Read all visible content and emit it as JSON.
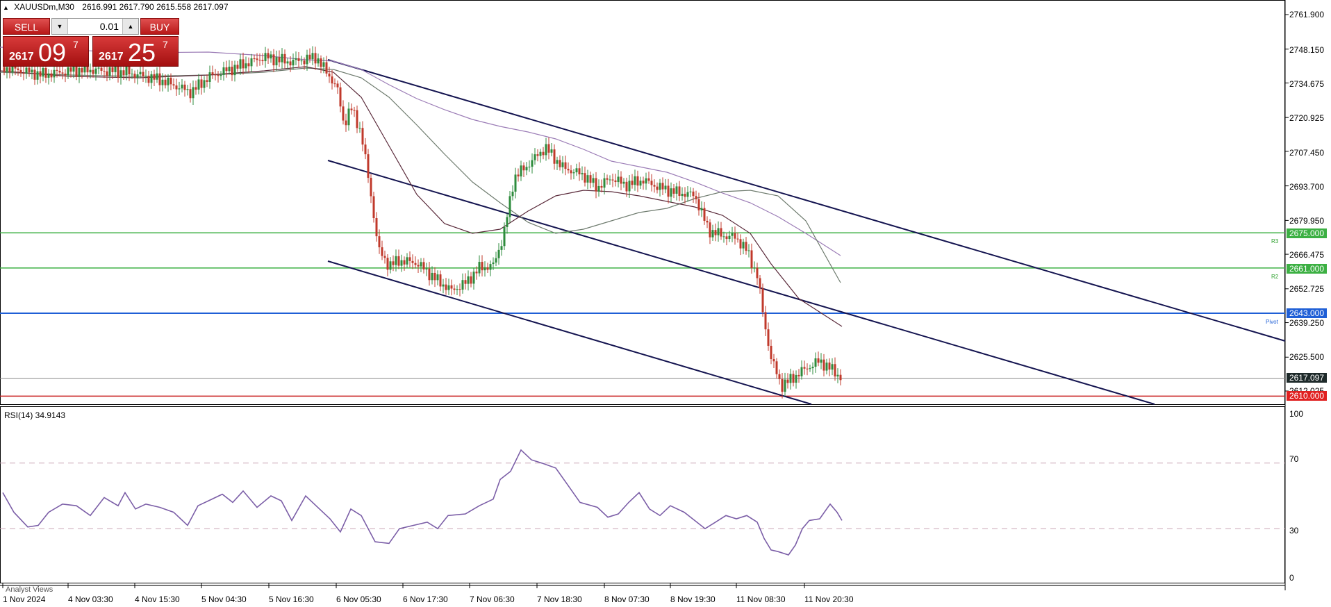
{
  "header": {
    "symbol": "XAUUSDm,M30",
    "ohlc": "2616.991 2617.790 2615.558 2617.097"
  },
  "trade_panel": {
    "sell_label": "SELL",
    "buy_label": "BUY",
    "volume": "0.01",
    "sell_price": {
      "big": "2617",
      "large": "09",
      "sup": "7"
    },
    "buy_price": {
      "big": "2617",
      "large": "25",
      "sup": "7"
    }
  },
  "price_axis": {
    "labels": [
      "2761.900",
      "2748.150",
      "2734.675",
      "2720.925",
      "2707.450",
      "2693.700",
      "2679.950",
      "2666.475",
      "2652.725",
      "2639.250",
      "2625.500",
      "2612.025"
    ]
  },
  "levels": [
    {
      "price": "2675.000",
      "tag": "R3",
      "color": "#2ca02c"
    },
    {
      "price": "2661.000",
      "tag": "R2",
      "color": "#2ca02c"
    },
    {
      "price": "2643.000",
      "tag": "Pivot",
      "color": "#1f5fd6"
    },
    {
      "price": "2610.000",
      "tag": "",
      "color": "#d62728"
    }
  ],
  "current_price": "2617.097",
  "rsi": {
    "label": "RSI(14) 34.9143",
    "axis_labels": [
      "100",
      "70",
      "30",
      "0"
    ],
    "line_color": "#7b5ea7"
  },
  "time_axis": {
    "labels": [
      "1 Nov 2024",
      "4 Nov 03:30",
      "4 Nov 15:30",
      "5 Nov 04:30",
      "5 Nov 16:30",
      "6 Nov 05:30",
      "6 Nov 17:30",
      "7 Nov 06:30",
      "7 Nov 18:30",
      "8 Nov 07:30",
      "8 Nov 19:30",
      "11 Nov 08:30",
      "11 Nov 20:30"
    ]
  },
  "footer": {
    "analyst": "Analyst Views"
  },
  "colors": {
    "bull": "#2e8b3c",
    "bear": "#c0392b",
    "channel": "#141450",
    "ma_dark": "#5a2a3a",
    "ma_gray": "#6e7b6e",
    "ma_purple": "#9b7cb6"
  }
}
